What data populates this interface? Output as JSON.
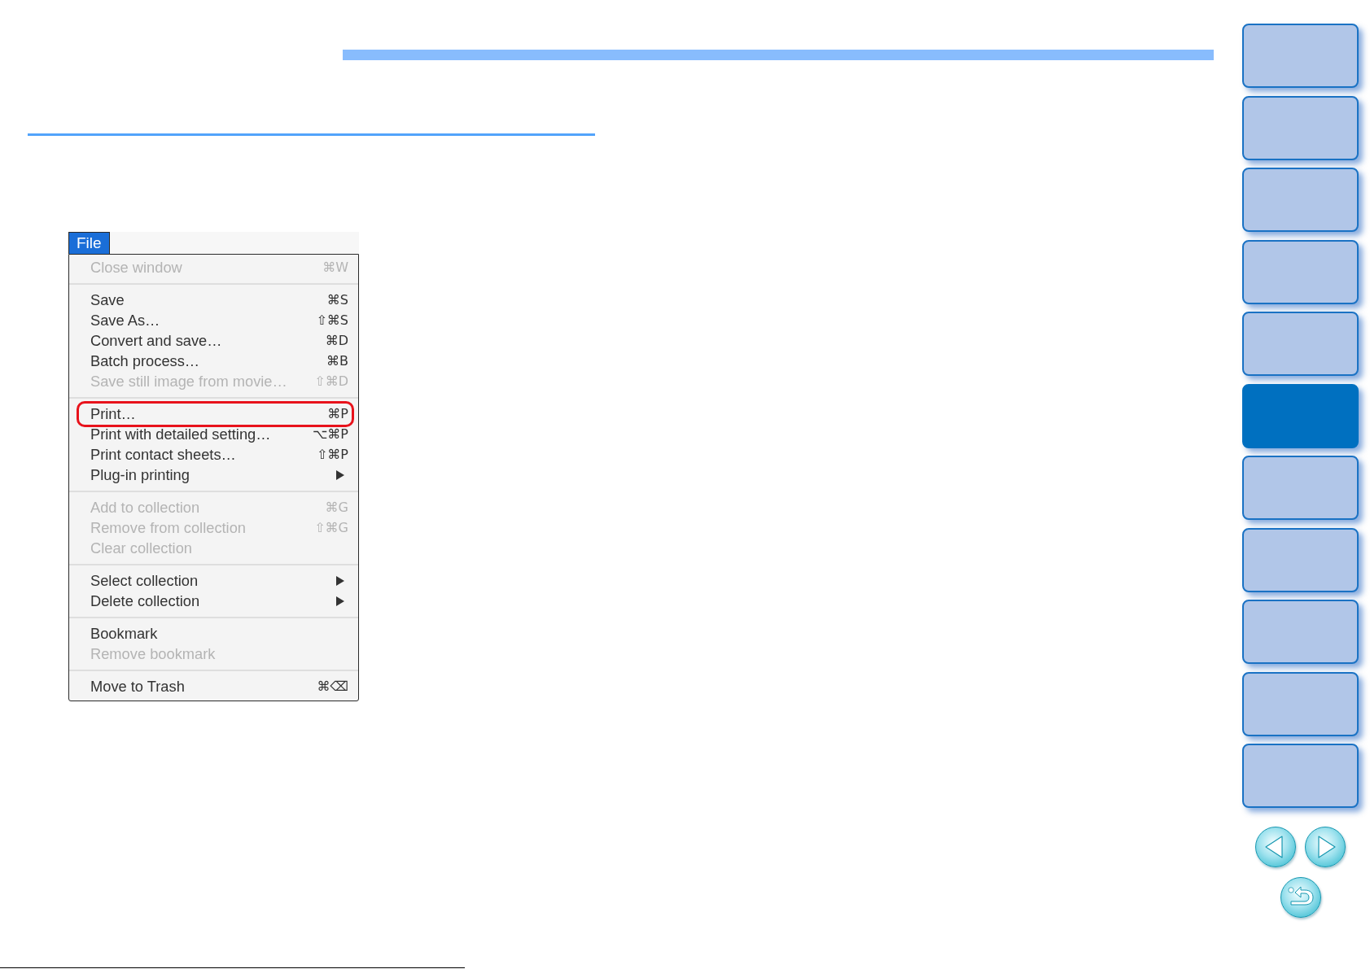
{
  "menu": {
    "title": "File",
    "selected": true,
    "sections": [
      {
        "items": [
          {
            "label": "Close window",
            "shortcut": "⌘W",
            "disabled": true,
            "submenu": false,
            "outlined": false
          }
        ]
      },
      {
        "items": [
          {
            "label": "Save",
            "shortcut": "⌘S",
            "disabled": false,
            "submenu": false,
            "outlined": false
          },
          {
            "label": "Save As…",
            "shortcut": "⇧⌘S",
            "disabled": false,
            "submenu": false,
            "outlined": false
          },
          {
            "label": "Convert and save…",
            "shortcut": "⌘D",
            "disabled": false,
            "submenu": false,
            "outlined": false
          },
          {
            "label": "Batch process…",
            "shortcut": "⌘B",
            "disabled": false,
            "submenu": false,
            "outlined": false
          },
          {
            "label": "Save still image from movie…",
            "shortcut": "⇧⌘D",
            "disabled": true,
            "submenu": false,
            "outlined": false
          }
        ]
      },
      {
        "items": [
          {
            "label": "Print…",
            "shortcut": "⌘P",
            "disabled": false,
            "submenu": false,
            "outlined": true
          },
          {
            "label": "Print with detailed setting…",
            "shortcut": "⌥⌘P",
            "disabled": false,
            "submenu": false,
            "outlined": false
          },
          {
            "label": "Print contact sheets…",
            "shortcut": "⇧⌘P",
            "disabled": false,
            "submenu": false,
            "outlined": false
          },
          {
            "label": "Plug-in printing",
            "disabled": false,
            "submenu": true,
            "outlined": false
          }
        ]
      },
      {
        "items": [
          {
            "label": "Add to collection",
            "shortcut": "⌘G",
            "disabled": true,
            "submenu": false,
            "outlined": false
          },
          {
            "label": "Remove from collection",
            "shortcut": "⇧⌘G",
            "disabled": true,
            "submenu": false,
            "outlined": false
          },
          {
            "label": "Clear collection",
            "disabled": true,
            "submenu": false,
            "outlined": false
          }
        ]
      },
      {
        "items": [
          {
            "label": "Select collection",
            "disabled": false,
            "submenu": true,
            "outlined": false
          },
          {
            "label": "Delete collection",
            "disabled": false,
            "submenu": true,
            "outlined": false
          }
        ]
      },
      {
        "items": [
          {
            "label": "Bookmark",
            "disabled": false,
            "submenu": false,
            "outlined": false
          },
          {
            "label": "Remove bookmark",
            "disabled": true,
            "submenu": false,
            "outlined": false
          }
        ]
      },
      {
        "items": [
          {
            "label": "Move to Trash",
            "shortcut": "⌘⌫",
            "disabled": false,
            "submenu": false,
            "outlined": false
          }
        ]
      }
    ]
  },
  "side_nav": {
    "tabs": [
      {
        "selected": false
      },
      {
        "selected": false
      },
      {
        "selected": false
      },
      {
        "selected": false
      },
      {
        "selected": false
      },
      {
        "selected": true
      },
      {
        "selected": false
      },
      {
        "selected": false
      },
      {
        "selected": false
      },
      {
        "selected": false
      },
      {
        "selected": false
      }
    ]
  }
}
